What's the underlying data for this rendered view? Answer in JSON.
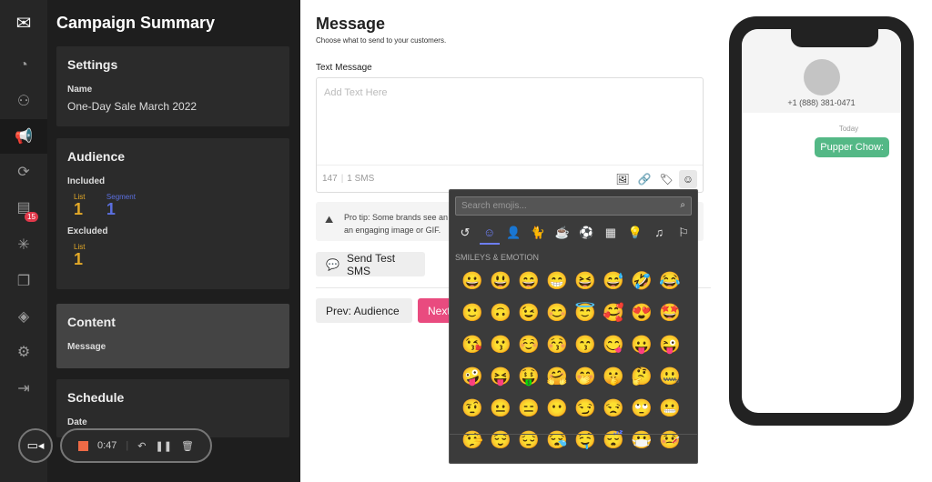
{
  "sidebar": {
    "badge": "15",
    "icons": [
      "logo-mail-icon",
      "dashboard-icon",
      "audience-icon",
      "campaigns-icon",
      "automation-icon",
      "messages-icon",
      "clicks-icon",
      "media-icon",
      "integrations-icon",
      "settings-icon",
      "logout-icon"
    ]
  },
  "summary": {
    "title": "Campaign Summary",
    "settings": {
      "heading": "Settings",
      "name_label": "Name",
      "name_value": "One-Day Sale March 2022"
    },
    "audience": {
      "heading": "Audience",
      "included_label": "Included",
      "list_label": "List",
      "list_count": "1",
      "segment_label": "Segment",
      "segment_count": "1",
      "excluded_label": "Excluded",
      "excluded_list_label": "List",
      "excluded_list_count": "1"
    },
    "content": {
      "heading": "Content",
      "message_label": "Message"
    },
    "schedule": {
      "heading": "Schedule",
      "date_label": "Date"
    }
  },
  "recorder": {
    "time": "0:47"
  },
  "message": {
    "title": "Message",
    "subtitle": "Choose what to send to your customers.",
    "text_label": "Text Message",
    "placeholder": "Add Text Here",
    "char_count": "147",
    "sms_count": "1 SMS",
    "tip": "Pro tip: Some brands see an ... an engaging image or GIF.",
    "tip_line1": "Pro tip: Some brands see an",
    "tip_line2": "an engaging image or GIF.",
    "send_test": "Send Test SMS",
    "prev": "Prev: Audience",
    "next": "Next"
  },
  "colors": {
    "accent": "#e94b7f",
    "green_bubble": "#54b886",
    "list": "#e3a928",
    "segment": "#5b6fe0",
    "picker_active": "#6d7ef5"
  },
  "emoji_picker": {
    "search_placeholder": "Search emojis...",
    "section": "SMILEYS & EMOTION",
    "categories": [
      "recent",
      "smileys",
      "people",
      "animals",
      "food",
      "activities",
      "places",
      "objects",
      "symbols",
      "flags"
    ],
    "emojis": [
      "😀",
      "😃",
      "😄",
      "😁",
      "😆",
      "😅",
      "🤣",
      "😂",
      "🙂",
      "🙃",
      "😉",
      "😊",
      "😇",
      "🥰",
      "😍",
      "🤩",
      "😘",
      "😗",
      "☺️",
      "😚",
      "😙",
      "😋",
      "😛",
      "😜",
      "🤪",
      "😝",
      "🤑",
      "🤗",
      "🤭",
      "🤫",
      "🤔",
      "🤐",
      "🤨",
      "😐",
      "😑",
      "😶",
      "😏",
      "😒",
      "🙄",
      "😬",
      "🤥",
      "😌",
      "😔",
      "😪",
      "🤤",
      "😴",
      "😷",
      "🤒"
    ]
  },
  "phone": {
    "number": "+1 (888) 381-0471",
    "day": "Today",
    "message": "Pupper Chow:"
  }
}
